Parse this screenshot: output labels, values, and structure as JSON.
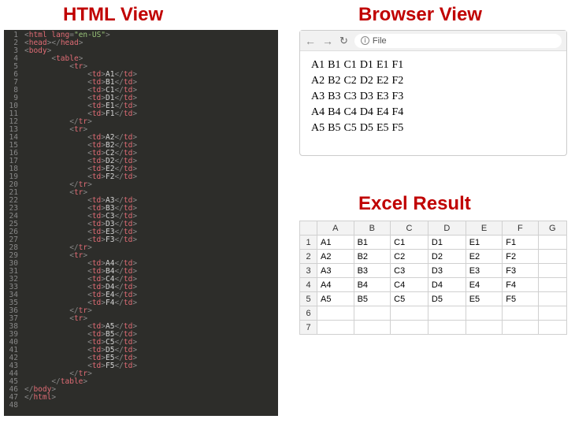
{
  "titles": {
    "html": "HTML View",
    "browser": "Browser View",
    "excel": "Excel Result"
  },
  "code": {
    "lang_attr": "en-US",
    "line_count": 48,
    "rows": [
      [
        "A1",
        "B1",
        "C1",
        "D1",
        "E1",
        "F1"
      ],
      [
        "A2",
        "B2",
        "C2",
        "D2",
        "E2",
        "F2"
      ],
      [
        "A3",
        "B3",
        "C3",
        "D3",
        "E3",
        "F3"
      ],
      [
        "A4",
        "B4",
        "C4",
        "D4",
        "E4",
        "F4"
      ],
      [
        "A5",
        "B5",
        "C5",
        "D5",
        "E5",
        "F5"
      ]
    ]
  },
  "browser": {
    "address": "File",
    "rows": [
      [
        "A1",
        "B1",
        "C1",
        "D1",
        "E1",
        "F1"
      ],
      [
        "A2",
        "B2",
        "C2",
        "D2",
        "E2",
        "F2"
      ],
      [
        "A3",
        "B3",
        "C3",
        "D3",
        "E3",
        "F3"
      ],
      [
        "A4",
        "B4",
        "C4",
        "D4",
        "E4",
        "F4"
      ],
      [
        "A5",
        "B5",
        "C5",
        "D5",
        "E5",
        "F5"
      ]
    ]
  },
  "excel": {
    "columns": [
      "A",
      "B",
      "C",
      "D",
      "E",
      "F",
      "G"
    ],
    "row_headers": [
      "1",
      "2",
      "3",
      "4",
      "5",
      "6",
      "7"
    ],
    "rows": [
      [
        "A1",
        "B1",
        "C1",
        "D1",
        "E1",
        "F1",
        ""
      ],
      [
        "A2",
        "B2",
        "C2",
        "D2",
        "E2",
        "F2",
        ""
      ],
      [
        "A3",
        "B3",
        "C3",
        "D3",
        "E3",
        "F3",
        ""
      ],
      [
        "A4",
        "B4",
        "C4",
        "D4",
        "E4",
        "F4",
        ""
      ],
      [
        "A5",
        "B5",
        "C5",
        "D5",
        "E5",
        "F5",
        ""
      ],
      [
        "",
        "",
        "",
        "",
        "",
        "",
        ""
      ],
      [
        "",
        "",
        "",
        "",
        "",
        "",
        ""
      ]
    ]
  },
  "chart_data": {
    "type": "table",
    "title": "Excel Result",
    "columns": [
      "A",
      "B",
      "C",
      "D",
      "E",
      "F",
      "G"
    ],
    "rows": [
      [
        "A1",
        "B1",
        "C1",
        "D1",
        "E1",
        "F1",
        ""
      ],
      [
        "A2",
        "B2",
        "C2",
        "D2",
        "E2",
        "F2",
        ""
      ],
      [
        "A3",
        "B3",
        "C3",
        "D3",
        "E3",
        "F3",
        ""
      ],
      [
        "A4",
        "B4",
        "C4",
        "D4",
        "E4",
        "F4",
        ""
      ],
      [
        "A5",
        "B5",
        "C5",
        "D5",
        "E5",
        "F5",
        ""
      ],
      [
        "",
        "",
        "",
        "",
        "",
        "",
        ""
      ],
      [
        "",
        "",
        "",
        "",
        "",
        "",
        ""
      ]
    ]
  }
}
